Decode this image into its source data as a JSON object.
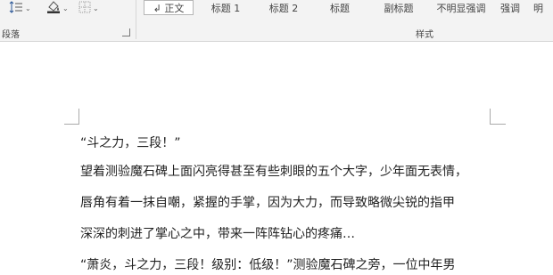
{
  "ribbon": {
    "paragraph_group": {
      "label": "段落",
      "tools": [
        {
          "icon": "line-spacing-icon"
        },
        {
          "icon": "shading-icon"
        },
        {
          "icon": "borders-icon"
        }
      ]
    },
    "styles_group": {
      "label": "样式",
      "items": [
        {
          "label": "↲ 正文",
          "selected": true
        },
        {
          "label": "标题 1"
        },
        {
          "label": "标题 2"
        },
        {
          "label": "标题"
        },
        {
          "label": "副标题"
        },
        {
          "label": "不明显强调"
        },
        {
          "label": "强调"
        },
        {
          "label": "明"
        }
      ]
    }
  },
  "document": {
    "lines": [
      "“斗之力，三段！”",
      "望着测验魔石碑上面闪亮得甚至有些刺眼的五个大字，少年面无表情，",
      "唇角有着一抹自嘲，紧握的手掌，因为大力，而导致略微尖锐的指甲",
      "深深的刺进了掌心之中，带来一阵阵钻心的疼痛…",
      "“萧炎，斗之力，三段！级别：低级！”测验魔石碑之旁，一位中年男"
    ]
  }
}
